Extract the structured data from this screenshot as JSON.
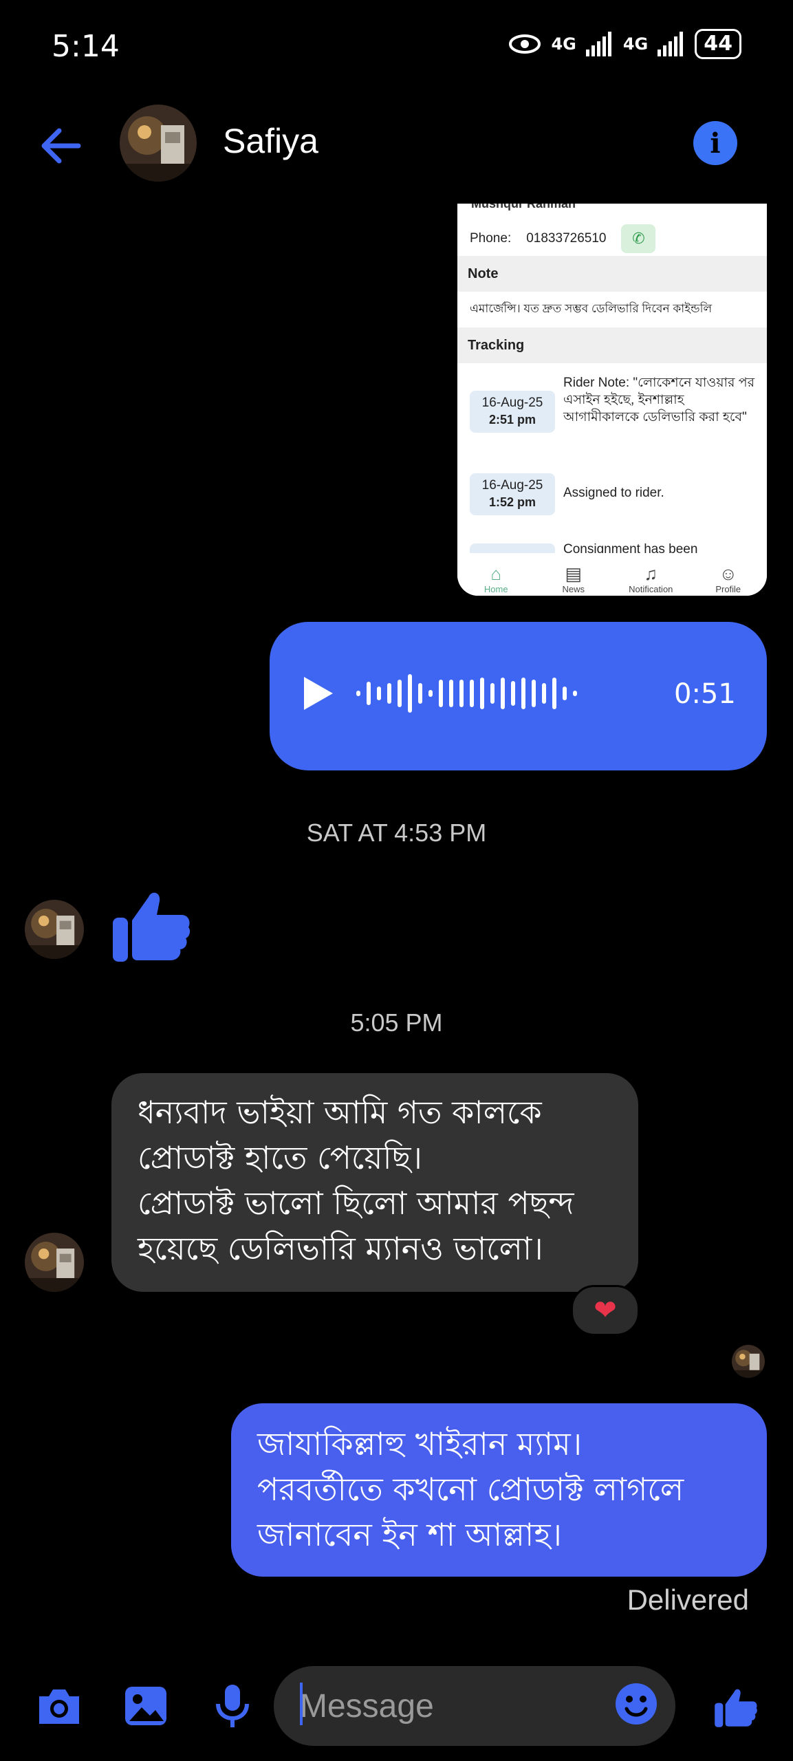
{
  "status_bar": {
    "time": "5:14",
    "net1": "4G",
    "net2": "4G",
    "battery": "44"
  },
  "header": {
    "contact_name": "Safiya"
  },
  "shared_screenshot": {
    "cut_name": "Mushqur Rahman",
    "phone_label": "Phone:",
    "phone_number": "01833726510",
    "note_heading": "Note",
    "note_text": "এমার্জেন্সি। যত দ্রুত সম্ভব ডেলিভারি দিবেন কাইন্ডলি",
    "tracking_heading": "Tracking",
    "tracking": [
      {
        "date": "16-Aug-25",
        "time": "2:51 pm",
        "text": "Rider Note: \"লোকেশনে যাওয়ার পর এসাইন হইছে, ইনশাল্লাহ আগামীকালকে ডেলিভারি করা হবে\""
      },
      {
        "date": "16-Aug-25",
        "time": "1:52 pm",
        "text": "Assigned to rider."
      },
      {
        "date": "",
        "time": "",
        "text": "Consignment has been"
      }
    ],
    "nav": [
      "Home",
      "News",
      "Notification",
      "Profile"
    ]
  },
  "voice_message": {
    "duration": "0:51"
  },
  "timestamps": {
    "first": "SAT AT 4:53 PM",
    "second": "5:05 PM"
  },
  "incoming": {
    "lines": [
      "ধন্যবাদ ভাইয়া আমি গত কালকে",
      "প্রোডাক্ট হাতে পেয়েছি।",
      "প্রোডাক্ট ভালো ছিলো আমার পছন্দ",
      "হয়েছে ডেলিভারি ম্যানও ভালো।"
    ],
    "reaction": "❤"
  },
  "outgoing": {
    "lines": [
      "জাযাকিল্লাহু খাইরান ম্যাম।",
      "পরবর্তীতে কখনো প্রোডাক্ট লাগলে",
      "জানাবেন ইন শা আল্লাহ।"
    ],
    "status": "Delivered"
  },
  "composer": {
    "placeholder": "Message"
  },
  "colors": {
    "accent": "#3f66f2",
    "outgoing_bubble": "#4960ef",
    "incoming_bubble": "#333333"
  }
}
